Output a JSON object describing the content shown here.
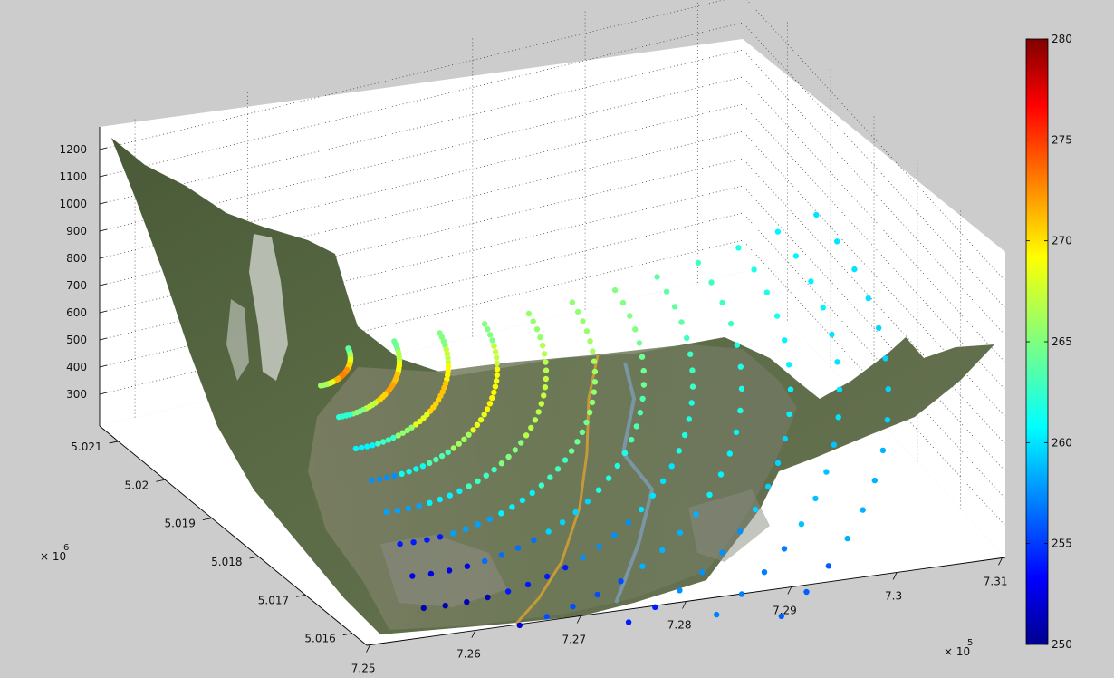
{
  "chart_data": {
    "type": "scatter",
    "subtype": "3d-scatter-over-terrain-surface",
    "title": "",
    "x_axis": {
      "ticks": [
        "7.25",
        "7.26",
        "7.27",
        "7.28",
        "7.29",
        "7.3",
        "7.31"
      ],
      "exponent_label": "× 10",
      "exponent": "5"
    },
    "y_axis": {
      "ticks": [
        "5.016",
        "5.017",
        "5.018",
        "5.019",
        "5.02",
        "5.021"
      ],
      "exponent_label": "× 10",
      "exponent": "6"
    },
    "z_axis": {
      "ticks": [
        "300",
        "400",
        "500",
        "600",
        "700",
        "800",
        "900",
        "1000",
        "1100",
        "1200"
      ]
    },
    "colorbar": {
      "ticks": [
        "250",
        "255",
        "260",
        "265",
        "270",
        "275",
        "280"
      ],
      "range": [
        250,
        280
      ],
      "colormap": "jet"
    },
    "series": [
      {
        "values": [
          264,
          266,
          268,
          270,
          272,
          272.5,
          271,
          268,
          266
        ]
      },
      {
        "values": [
          264.5,
          266.5,
          268.5,
          270.5,
          271.5,
          270,
          267,
          265,
          262.5
        ]
      },
      {
        "values": [
          265,
          267,
          269,
          270.5,
          270,
          268,
          265.5,
          263,
          261
        ]
      },
      {
        "values": [
          265,
          267,
          268.5,
          269,
          268,
          266,
          263.5,
          261.5,
          258
        ]
      },
      {
        "values": [
          265.5,
          266.5,
          267,
          266.5,
          265,
          263,
          261,
          258.5
        ]
      },
      {
        "values": [
          265.5,
          266,
          265.5,
          264.5,
          263,
          261,
          258.5,
          254.5
        ]
      },
      {
        "values": [
          265,
          264.5,
          263.5,
          262,
          260,
          257,
          253
        ]
      },
      {
        "values": [
          264,
          263,
          262,
          260.5,
          258,
          254.5,
          251.5
        ]
      },
      {
        "values": [
          263,
          262,
          261,
          259,
          256,
          252.5
        ]
      },
      {
        "values": [
          262,
          261,
          260,
          258,
          254.5,
          251.5
        ]
      },
      {
        "values": [
          261,
          260.5,
          259.5,
          257.5,
          254,
          251
        ]
      },
      {
        "values": [
          260.5,
          260,
          259,
          256.5,
          253.5,
          251
        ]
      }
    ],
    "grid": true
  },
  "colors": {
    "background": "#cccccc",
    "axes_background": "#ffffff",
    "terrain_base": "#55673f"
  }
}
